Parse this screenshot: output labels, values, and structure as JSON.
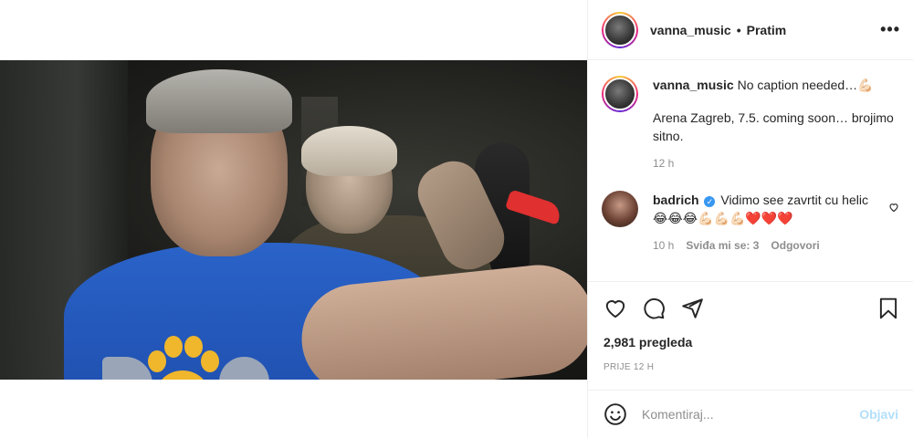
{
  "post": {
    "username": "vanna_music",
    "separator": "•",
    "follow_label": "Pratim",
    "more_label": "•••"
  },
  "caption": {
    "username": "vanna_music",
    "line1": "No caption needed…💪🏻",
    "line2": "Arena Zagreb, 7.5. coming soon… brojimo sitno.",
    "time": "12 h"
  },
  "comments": [
    {
      "username": "badrich",
      "verified": true,
      "text": "Vidimo see zavrtit cu helic😂😂😂💪🏻💪🏻💪🏻❤️❤️❤️",
      "time": "10 h",
      "likes_label": "Sviđa mi se: 3",
      "reply_label": "Odgovori"
    }
  ],
  "stats": {
    "views": "2,981 pregleda",
    "posted_ago": "PRIJE 12 H"
  },
  "composer": {
    "placeholder": "Komentiraj...",
    "post_label": "Objavi"
  },
  "icons": {
    "like": "heart-outline",
    "comment": "speech-bubble",
    "share": "paper-plane",
    "save": "bookmark",
    "emoji": "smiley-face",
    "verified": "check-badge"
  },
  "colors": {
    "text": "#262626",
    "muted": "#8e8e8e",
    "verified": "#3897f0",
    "post_disabled": "#b2dffc",
    "divider": "#efefef"
  }
}
